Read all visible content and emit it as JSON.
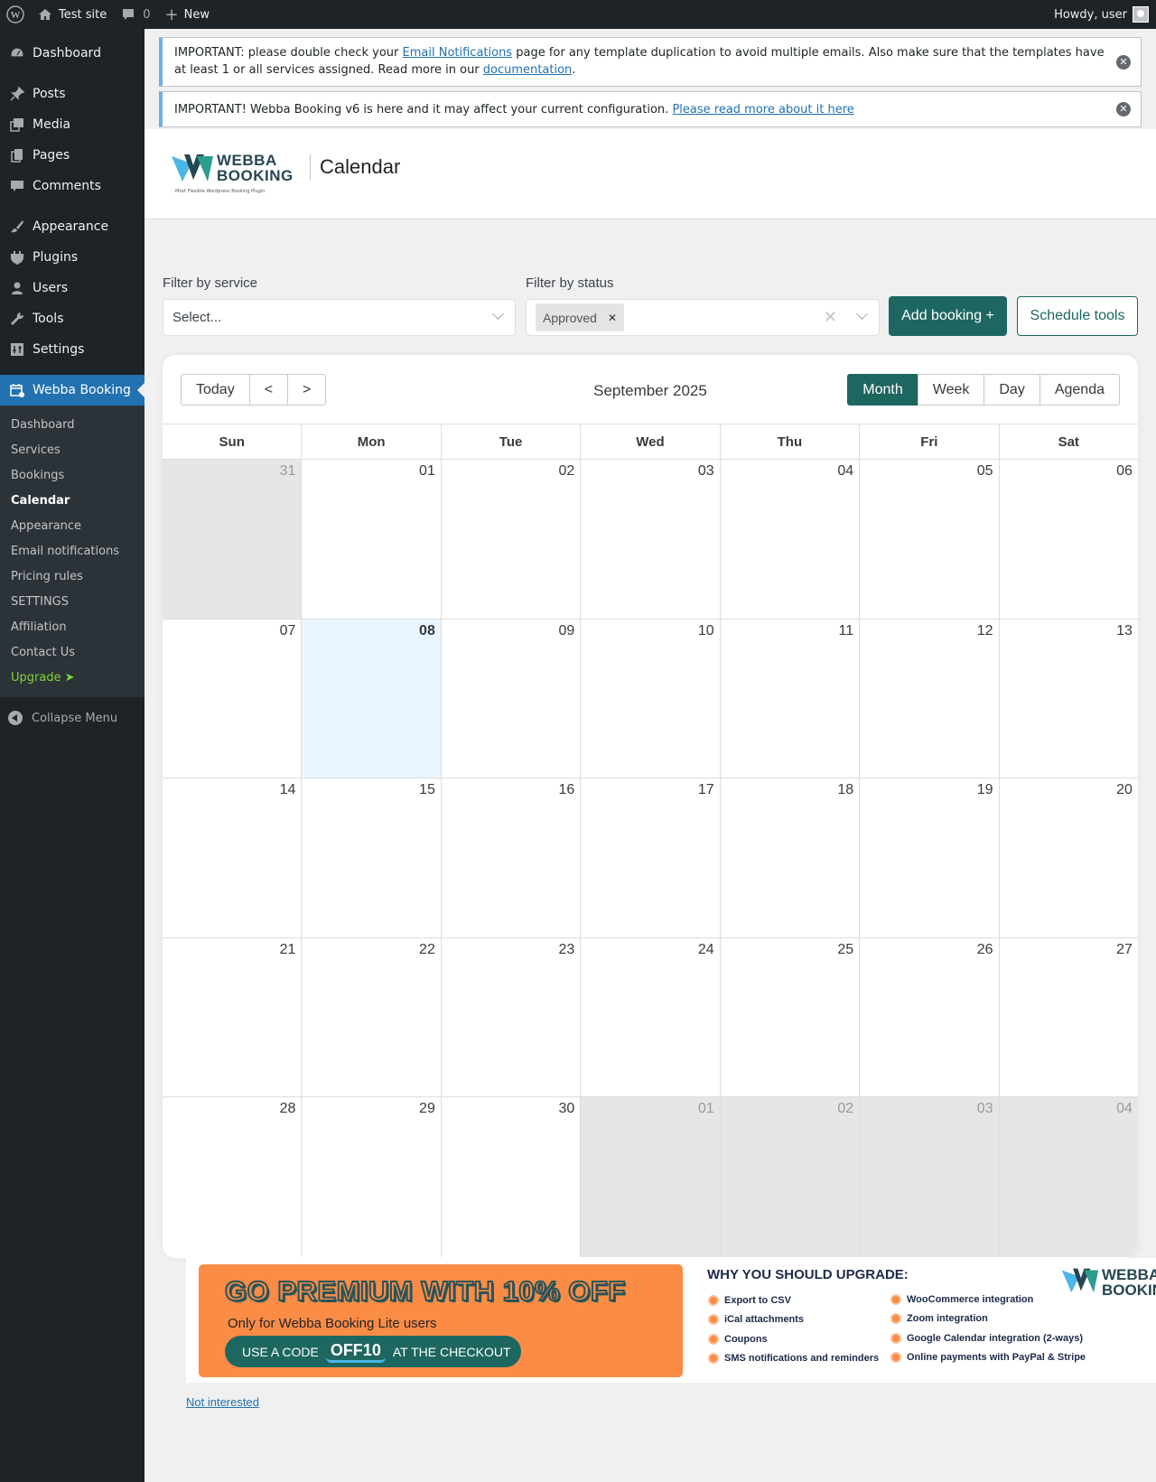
{
  "adminbar": {
    "site_name": "Test site",
    "comments_count": "0",
    "new_label": "New",
    "howdy": "Howdy, user"
  },
  "sidebar": {
    "items": [
      {
        "label": "Dashboard",
        "icon": "dashboard-icon"
      },
      {
        "label": "Posts",
        "icon": "pin-icon"
      },
      {
        "label": "Media",
        "icon": "media-icon"
      },
      {
        "label": "Pages",
        "icon": "pages-icon"
      },
      {
        "label": "Comments",
        "icon": "comment-icon"
      },
      {
        "label": "Appearance",
        "icon": "brush-icon"
      },
      {
        "label": "Plugins",
        "icon": "plugin-icon"
      },
      {
        "label": "Users",
        "icon": "user-icon"
      },
      {
        "label": "Tools",
        "icon": "wrench-icon"
      },
      {
        "label": "Settings",
        "icon": "settings-icon"
      },
      {
        "label": "Webba Booking",
        "icon": "calendar-icon"
      }
    ],
    "submenu": [
      "Dashboard",
      "Services",
      "Bookings",
      "Calendar",
      "Appearance",
      "Email notifications",
      "Pricing rules",
      "SETTINGS",
      "Affiliation",
      "Contact Us",
      "Upgrade ➤"
    ],
    "collapse_label": "Collapse Menu"
  },
  "notices": {
    "n1_pre": "IMPORTANT: please double check your ",
    "n1_link1": "Email Notifications",
    "n1_mid": " page for any template duplication to avoid multiple emails. Also make sure that the templates have at least 1 or all services assigned. Read more in our ",
    "n1_link2": "documentation",
    "n1_post": ".",
    "n2_pre": "IMPORTANT! Webba Booking v6 is here and it may affect your current configuration. ",
    "n2_link": "Please read more about it here"
  },
  "header": {
    "logo_line1": "WEBBA",
    "logo_line2": "BOOKING",
    "logo_tagline": "Most Flexible Wordpress Booking Plugin",
    "title": "Calendar"
  },
  "filters": {
    "service_label": "Filter by service",
    "service_placeholder": "Select...",
    "status_label": "Filter by status",
    "status_chip": "Approved",
    "add_booking": "Add booking +",
    "schedule_tools": "Schedule tools"
  },
  "calendar": {
    "nav": [
      "Today",
      "<",
      ">"
    ],
    "label": "September 2025",
    "views": [
      "Month",
      "Week",
      "Day",
      "Agenda"
    ],
    "active_view": "Month",
    "weekdays": [
      "Sun",
      "Mon",
      "Tue",
      "Wed",
      "Thu",
      "Fri",
      "Sat"
    ],
    "weeks": [
      [
        {
          "d": "31",
          "off": true
        },
        {
          "d": "01"
        },
        {
          "d": "02"
        },
        {
          "d": "03"
        },
        {
          "d": "04"
        },
        {
          "d": "05"
        },
        {
          "d": "06"
        }
      ],
      [
        {
          "d": "07"
        },
        {
          "d": "08",
          "today": true
        },
        {
          "d": "09"
        },
        {
          "d": "10"
        },
        {
          "d": "11"
        },
        {
          "d": "12"
        },
        {
          "d": "13"
        }
      ],
      [
        {
          "d": "14"
        },
        {
          "d": "15"
        },
        {
          "d": "16"
        },
        {
          "d": "17"
        },
        {
          "d": "18"
        },
        {
          "d": "19"
        },
        {
          "d": "20"
        }
      ],
      [
        {
          "d": "21"
        },
        {
          "d": "22"
        },
        {
          "d": "23"
        },
        {
          "d": "24"
        },
        {
          "d": "25"
        },
        {
          "d": "26"
        },
        {
          "d": "27"
        }
      ],
      [
        {
          "d": "28"
        },
        {
          "d": "29"
        },
        {
          "d": "30"
        },
        {
          "d": "01",
          "off": true
        },
        {
          "d": "02",
          "off": true
        },
        {
          "d": "03",
          "off": true
        },
        {
          "d": "04",
          "off": true
        }
      ]
    ]
  },
  "banner": {
    "headline": "GO PREMIUM WITH 10% OFF",
    "subline": "Only for Webba Booking Lite users",
    "code_pre": "USE A CODE",
    "code": "OFF10",
    "code_post": "AT THE CHECKOUT",
    "why_title": "WHY YOU SHOULD UPGRADE:",
    "features_left": [
      "Export to CSV",
      "iCal attachments",
      "Coupons",
      "SMS notifications and reminders"
    ],
    "features_right": [
      "WooCommerce integration",
      "Zoom integration",
      "Google Calendar integration (2-ways)",
      "Online payments with PayPal & Stripe"
    ],
    "logo_line1": "WEBBA",
    "logo_line2": "BOOKING"
  },
  "not_interested": "Not interested",
  "colors": {
    "primary": "#1d6760",
    "wp_blue": "#2271b1",
    "promo_orange": "#fb8c46"
  }
}
